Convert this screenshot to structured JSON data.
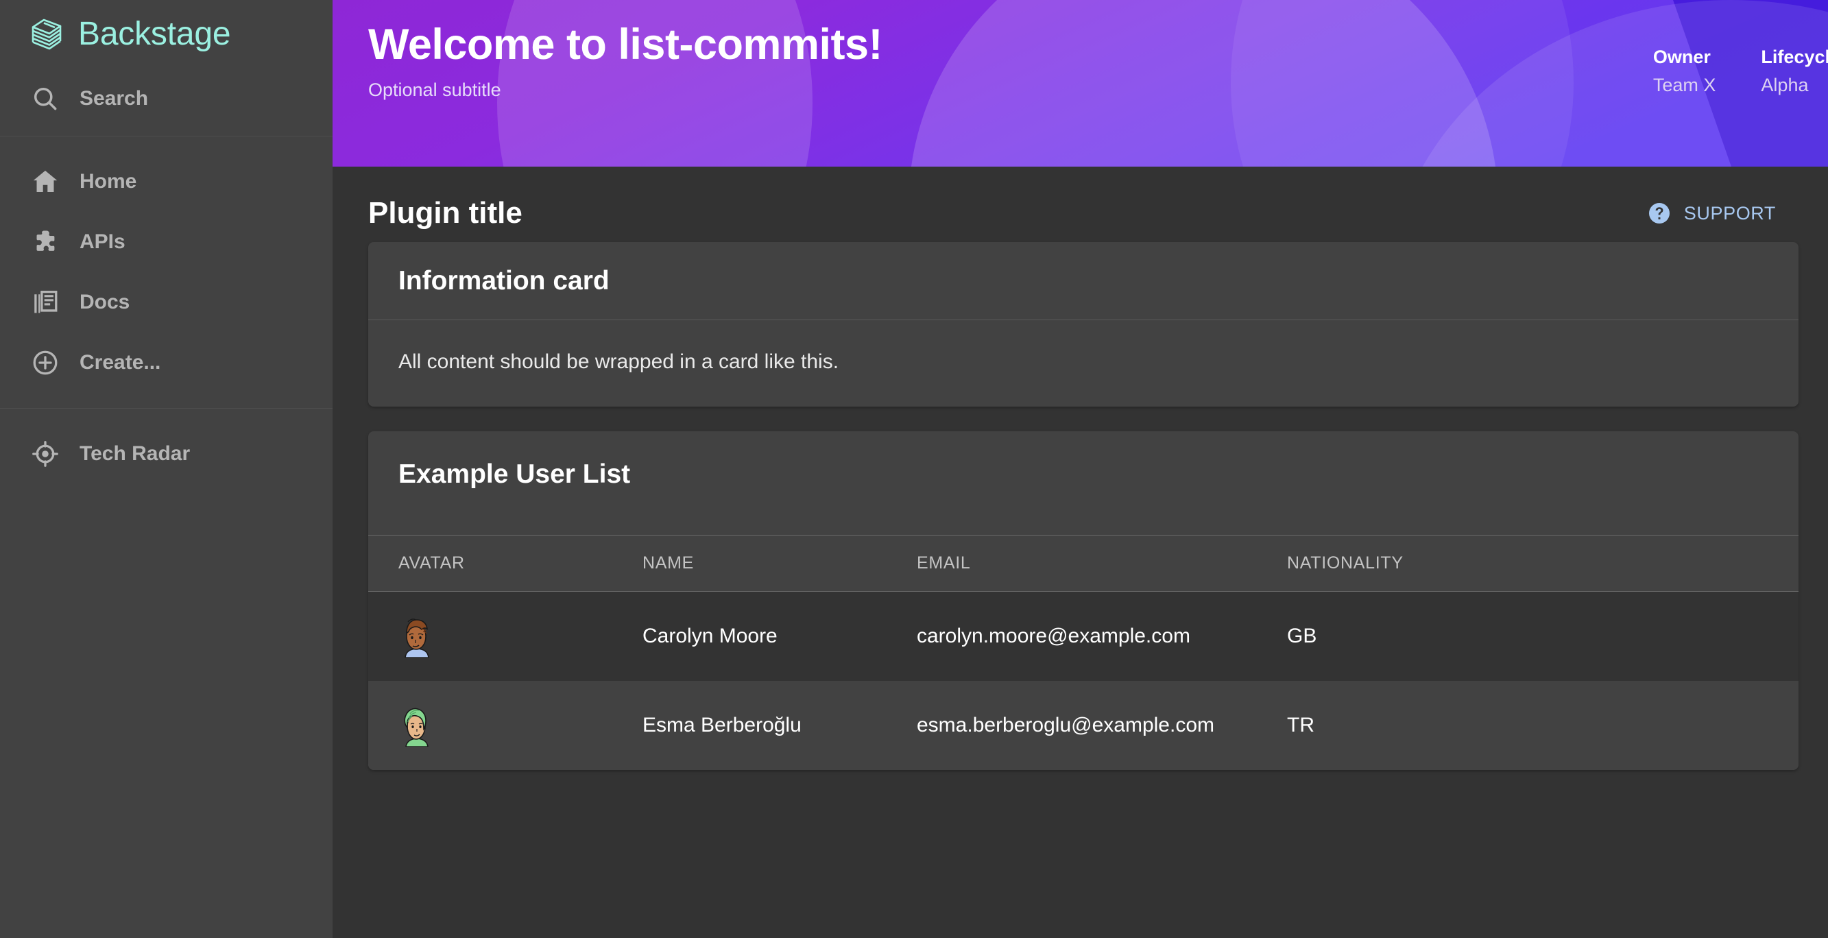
{
  "sidebar": {
    "brand": {
      "name": "Backstage",
      "logo_icon": "backstage-stack-logo",
      "color": "#9BF0E1"
    },
    "search": {
      "label": "Search",
      "icon": "search-icon"
    },
    "items": [
      {
        "label": "Home",
        "icon": "home-icon"
      },
      {
        "label": "APIs",
        "icon": "puzzle-piece-icon"
      },
      {
        "label": "Docs",
        "icon": "library-books-icon"
      },
      {
        "label": "Create...",
        "icon": "plus-circle-icon"
      }
    ],
    "secondary_items": [
      {
        "label": "Tech Radar",
        "icon": "target-crosshair-icon"
      }
    ]
  },
  "banner": {
    "title": "Welcome to list-commits!",
    "subtitle": "Optional subtitle",
    "gradient_from": "#8E27D6",
    "gradient_to": "#5E39F2",
    "meta": [
      {
        "label": "Owner",
        "value": "Team X"
      },
      {
        "label": "Lifecycle",
        "value": "Alpha"
      }
    ]
  },
  "page": {
    "title": "Plugin title",
    "support": {
      "label": "SUPPORT",
      "icon": "help-circle-icon",
      "color": "#a8c8f0"
    }
  },
  "info_card": {
    "title": "Information card",
    "body": "All content should be wrapped in a card like this."
  },
  "user_list_card": {
    "title": "Example User List",
    "columns": [
      "AVATAR",
      "NAME",
      "EMAIL",
      "NATIONALITY"
    ],
    "rows": [
      {
        "avatar_icon": "avatar-carolyn-moore",
        "name": "Carolyn Moore",
        "email": "carolyn.moore@example.com",
        "nationality": "GB"
      },
      {
        "avatar_icon": "avatar-esma-berberoglu",
        "name": "Esma Berberoğlu",
        "email": "esma.berberoglu@example.com",
        "nationality": "TR"
      }
    ]
  }
}
